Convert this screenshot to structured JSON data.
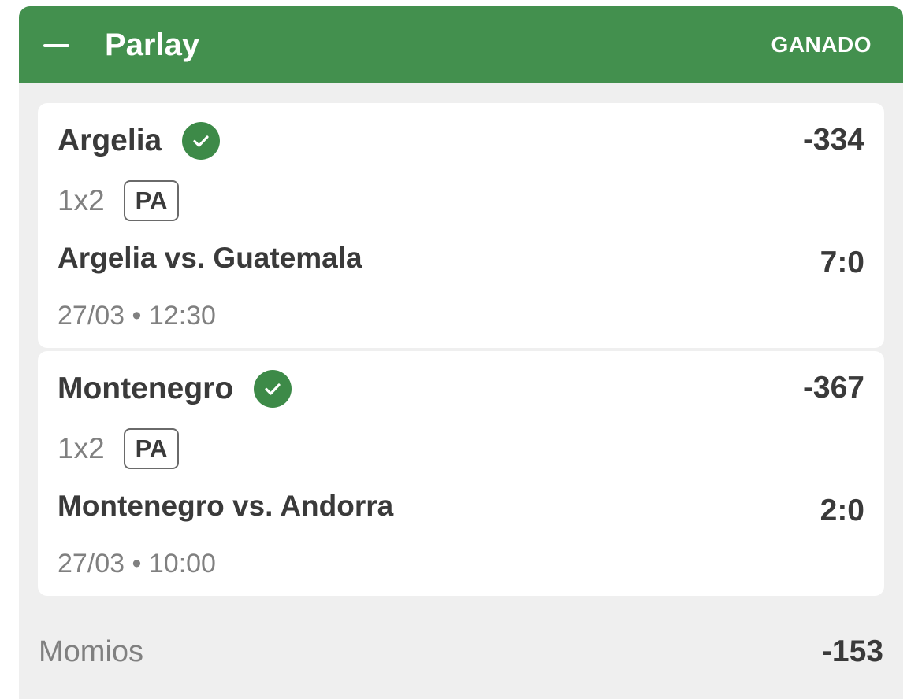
{
  "header": {
    "collapse_icon": "minus-icon",
    "title": "Parlay",
    "status": "GANADO"
  },
  "colors": {
    "header_green": "#43904e",
    "check_green": "#3d8a48",
    "panel_bg": "#efefef"
  },
  "selections": [
    {
      "team": "Argelia",
      "status_icon": "check-circle-icon",
      "odds": "-334",
      "market": "1x2",
      "badge": "PA",
      "match": "Argelia vs. Guatemala",
      "score": "7:0",
      "datetime": "27/03 • 12:30"
    },
    {
      "team": "Montenegro",
      "status_icon": "check-circle-icon",
      "odds": "-367",
      "market": "1x2",
      "badge": "PA",
      "match": "Montenegro vs. Andorra",
      "score": "2:0",
      "datetime": "27/03 • 10:00"
    }
  ],
  "summary": {
    "label": "Momios",
    "value": "-153"
  }
}
